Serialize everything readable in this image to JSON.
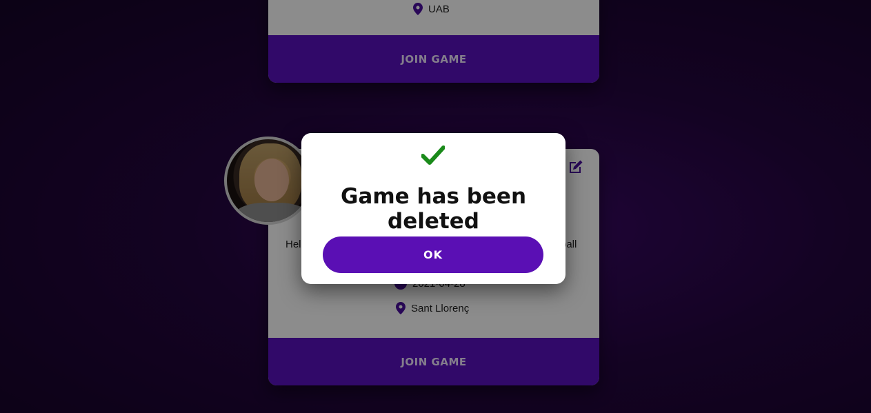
{
  "cards": [
    {
      "location": "UAB",
      "join_label": "JOIN GAME"
    },
    {
      "location": "Sant Llorenç",
      "date": "2021-04-28",
      "left_text": "Hel",
      "right_text": "ball",
      "join_label": "JOIN GAME"
    }
  ],
  "modal": {
    "title": "Game has been deleted",
    "ok_label": "OK",
    "check_color": "#1a8a1a"
  },
  "colors": {
    "accent": "#5a12c0",
    "background": "#1c0533"
  }
}
